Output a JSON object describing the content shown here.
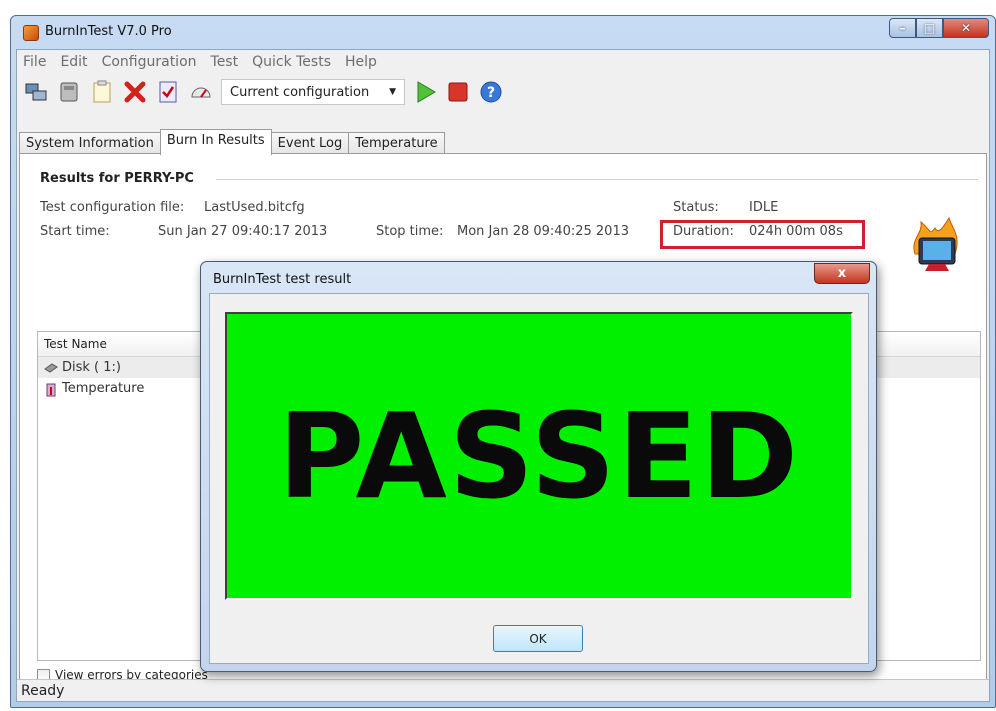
{
  "window": {
    "title": "BurnInTest V7.0 Pro"
  },
  "menu": [
    "File",
    "Edit",
    "Configuration",
    "Test",
    "Quick Tests",
    "Help"
  ],
  "toolbar": {
    "config_select": "Current configuration"
  },
  "tabs": [
    "System Information",
    "Burn In Results",
    "Event Log",
    "Temperature"
  ],
  "results": {
    "heading": "Results for PERRY-PC",
    "config_file_label": "Test configuration file:",
    "config_file": "LastUsed.bitcfg",
    "start_label": "Start time:",
    "start_value": "Sun Jan 27 09:40:17 2013",
    "stop_label": "Stop time:",
    "stop_value": "Mon Jan 28 09:40:25 2013",
    "status_label": "Status:",
    "status_value": "IDLE",
    "duration_label": "Duration:",
    "duration_value": "024h 00m 08s"
  },
  "list": {
    "header": "Test Name",
    "rows": [
      "Disk ( 1:)",
      "Temperature"
    ]
  },
  "view_errors_label": "View errors by categories",
  "status_bar": "Ready",
  "dialog": {
    "title": "BurnInTest test result",
    "close": "x",
    "result": "PASSED",
    "ok": "OK"
  },
  "colors": {
    "pass": "#00f000",
    "highlight_box": "#d02030"
  }
}
